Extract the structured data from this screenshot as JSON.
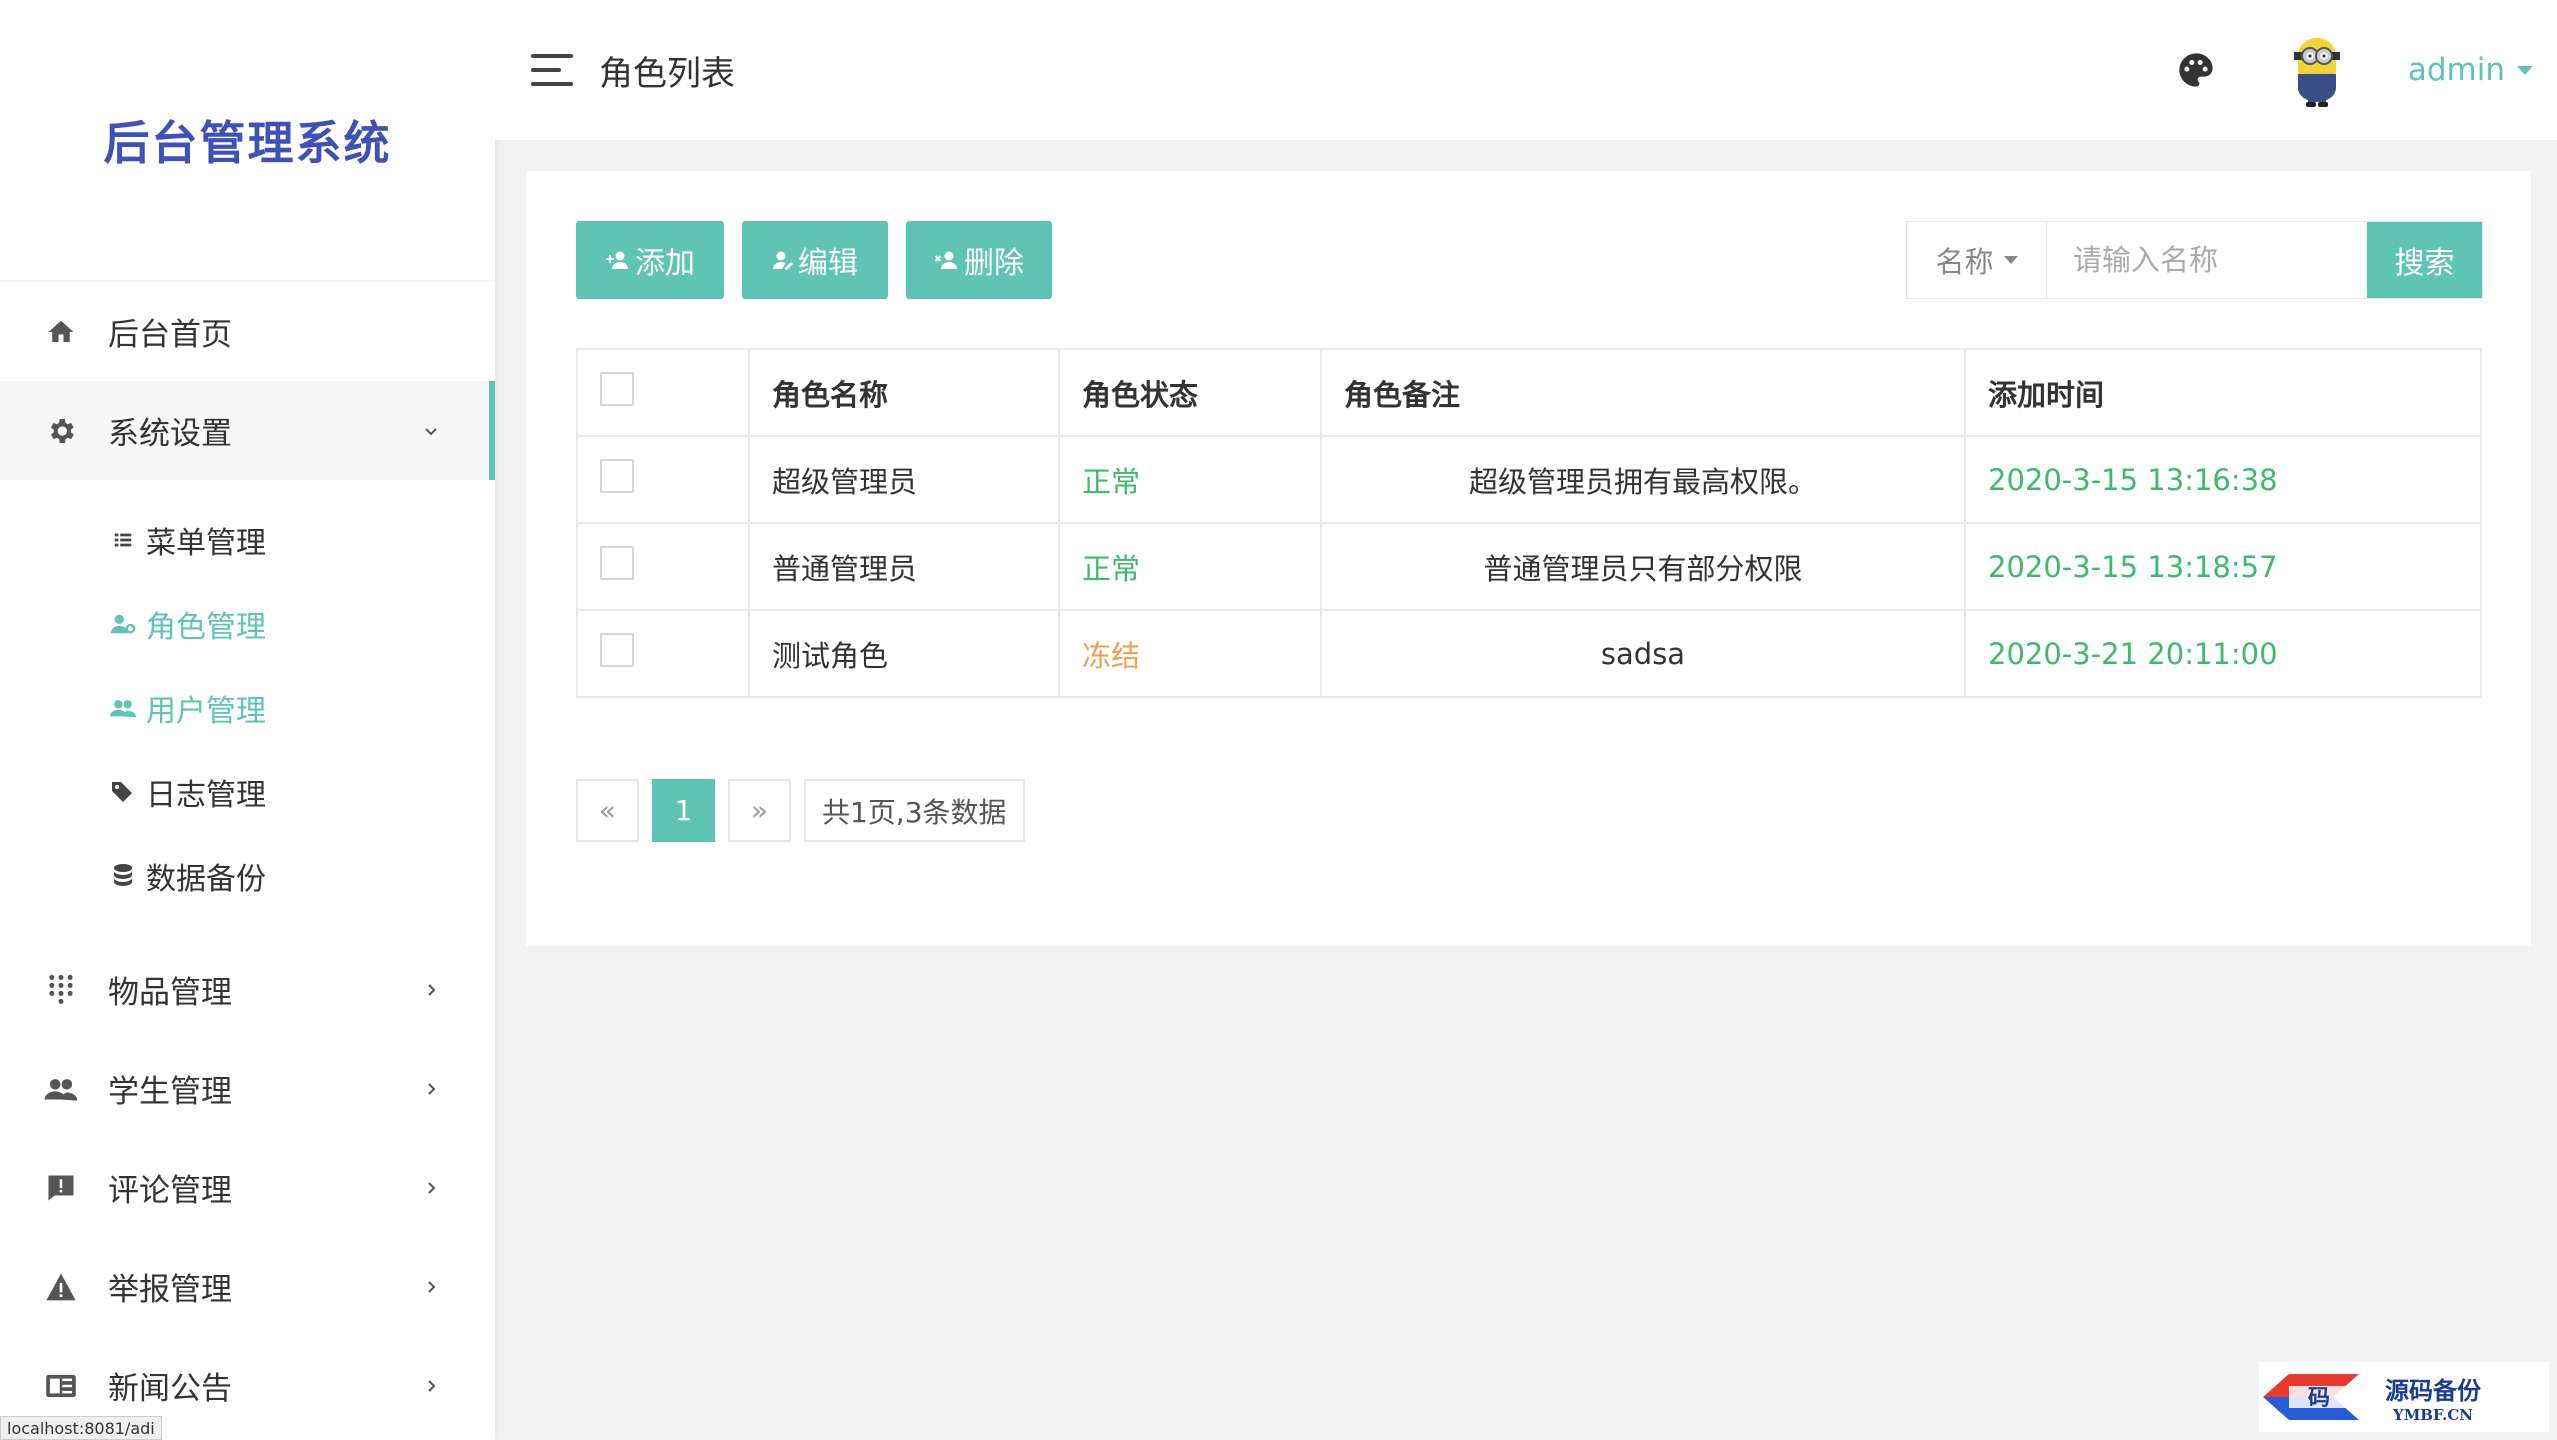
{
  "sidebar": {
    "logo": "后台管理系统",
    "home": {
      "label": "后台首页"
    },
    "system": {
      "label": "系统设置"
    },
    "submenu": [
      {
        "label": "菜单管理"
      },
      {
        "label": "角色管理"
      },
      {
        "label": "用户管理"
      },
      {
        "label": "日志管理"
      },
      {
        "label": "数据备份"
      }
    ],
    "items": [
      {
        "label": "物品管理"
      },
      {
        "label": "学生管理"
      },
      {
        "label": "评论管理"
      },
      {
        "label": "举报管理"
      },
      {
        "label": "新闻公告"
      }
    ]
  },
  "header": {
    "title": "角色列表",
    "user": "admin"
  },
  "toolbar": {
    "add": "添加",
    "edit": "编辑",
    "delete": "删除"
  },
  "search": {
    "field": "名称",
    "placeholder": "请输入名称",
    "button": "搜索"
  },
  "table": {
    "columns": [
      "角色名称",
      "角色状态",
      "角色备注",
      "添加时间"
    ],
    "rows": [
      {
        "name": "超级管理员",
        "status": "正常",
        "remark": "超级管理员拥有最高权限。",
        "time": "2020-3-15 13:16:38"
      },
      {
        "name": "普通管理员",
        "status": "正常",
        "remark": "普通管理员只有部分权限",
        "time": "2020-3-15 13:18:57"
      },
      {
        "name": "测试角色",
        "status": "冻结",
        "remark": "sadsa",
        "time": "2020-3-21 20:11:00"
      }
    ]
  },
  "pager": {
    "prev": "«",
    "current": "1",
    "next": "»",
    "info": "共1页,3条数据"
  },
  "status_bar": "localhost:8081/adi",
  "watermark": {
    "main": "源码备份",
    "sub": "YMBF.CN",
    "glyph": "码"
  },
  "colors": {
    "accent": "#5fc4b4",
    "normal": "#3fb96f",
    "frozen": "#f0a050",
    "logo": "#3f51b5"
  }
}
